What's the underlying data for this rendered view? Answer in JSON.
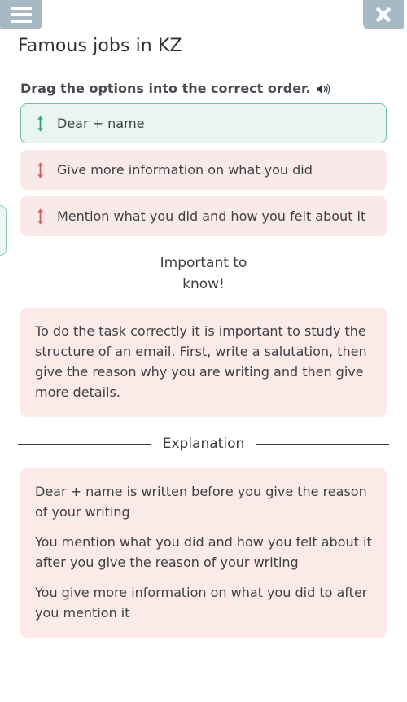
{
  "header": {
    "menu_icon": "hamburger-menu-icon",
    "close_icon": "close-icon",
    "title": "Famous jobs in KZ"
  },
  "prompt": {
    "text": "Drag the options into the correct order.",
    "audio_icon": "speaker-icon"
  },
  "options": [
    {
      "label": "Dear + name",
      "state": "correct",
      "handle_icon": "drag-updown-icon"
    },
    {
      "label": "Give more information on what you did",
      "state": "normal",
      "handle_icon": "drag-updown-icon"
    },
    {
      "label": "Mention what you did and how you felt about it",
      "state": "normal",
      "handle_icon": "drag-updown-icon"
    }
  ],
  "important": {
    "heading": "Important to know!",
    "body": "To do the task correctly it is important to study the structure of an email. First, write a salutation, then give the reason why you are writing and then give more details."
  },
  "explanation": {
    "heading": "Explanation",
    "items": [
      "Dear + name is written before you give the reason of your writing",
      "You mention what you did and how you felt about it after you give the reason of your writing",
      "You give more information on what you did to after you mention it"
    ]
  },
  "colors": {
    "header_button": "#a6b9c5",
    "correct_bg": "#e9f6f0",
    "correct_border": "#74c0a4",
    "correct_handle": "#2d9c86",
    "normal_bg": "#fae9e9",
    "normal_handle": "#cf5b5b",
    "box_bg": "#fbeae8",
    "text": "#3f3f46"
  }
}
